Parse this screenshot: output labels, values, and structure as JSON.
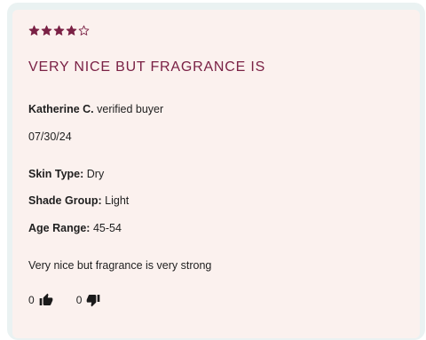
{
  "review": {
    "rating": 4,
    "rating_max": 5,
    "star_color": "#7a2145",
    "title": "VERY NICE BUT FRAGRANCE IS",
    "reviewer_name": "Katherine C.",
    "reviewer_badge": "verified buyer",
    "date": "07/30/24",
    "attributes": [
      {
        "label": "Skin Type:",
        "value": "Dry"
      },
      {
        "label": "Shade Group:",
        "value": "Light"
      },
      {
        "label": "Age Range:",
        "value": "45-54"
      }
    ],
    "body": "Very nice but fragrance is very strong",
    "helpful": {
      "up_count": "0",
      "down_count": "0"
    }
  },
  "icons": {
    "up": "thumbs-up-icon",
    "down": "thumbs-down-icon"
  },
  "colors": {
    "frame": "#eaf2f2",
    "card": "#fbf1ee",
    "title": "#7a2145",
    "text": "#1f1f1f"
  }
}
